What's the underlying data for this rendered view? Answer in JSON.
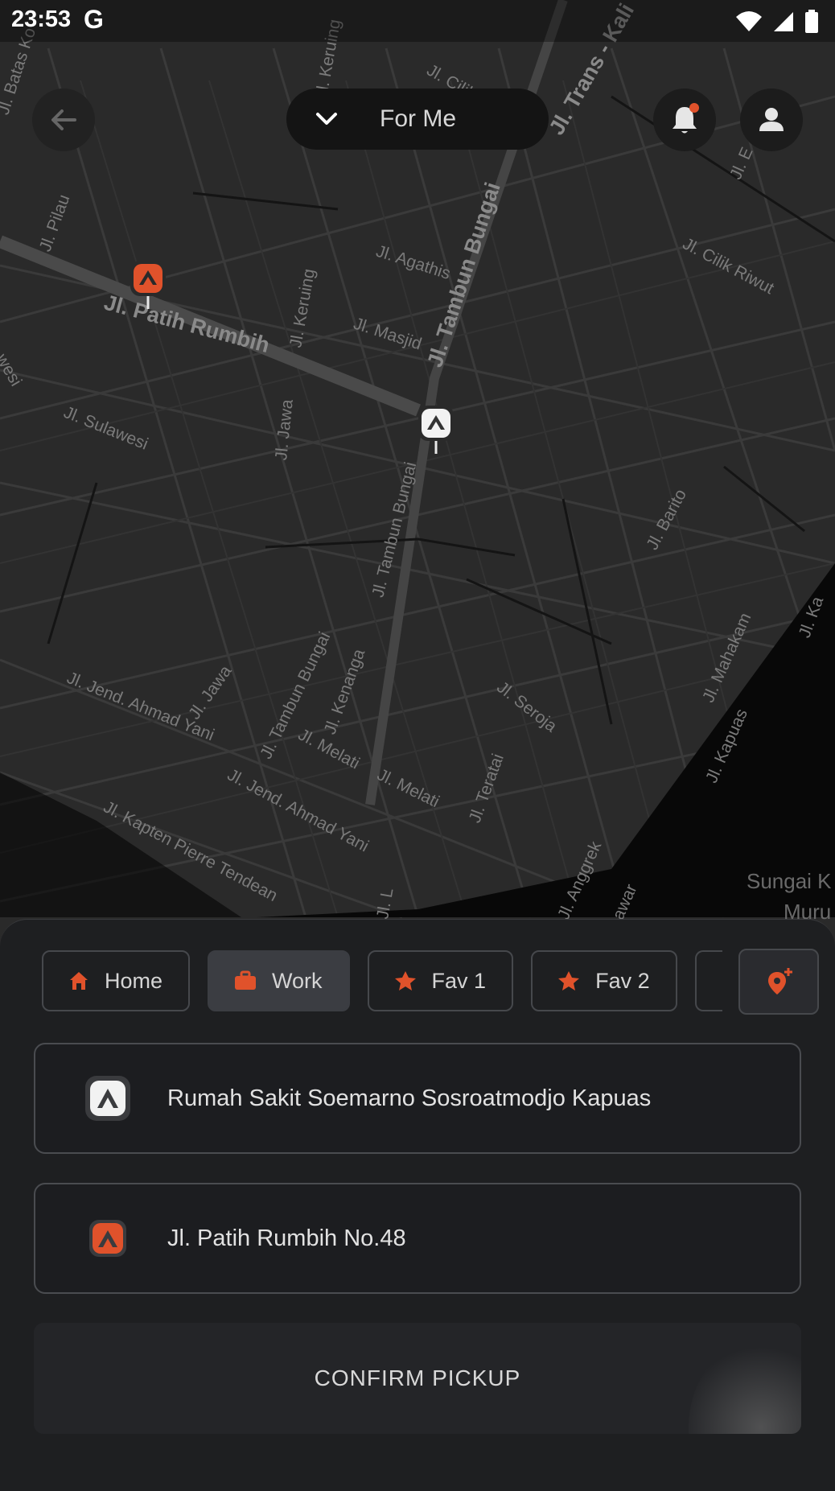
{
  "status_bar": {
    "time": "23:53",
    "app_glyph": "G"
  },
  "header": {
    "for_me_label": "For Me"
  },
  "map": {
    "streets": [
      "Jl. Trans - Kali",
      "Jl. Tambun Bungai",
      "Jl. Patih Rumbih",
      "Jl. Agathis",
      "Jl. Cilik Riwut",
      "Jl. Masjid",
      "Jl. Keruing",
      "Jl. Keruing",
      "Jl. Pilau",
      "Jl. Sulawesi",
      "Jl. Jawa",
      "Jl. Tambun Bungai",
      "Jl. Barito",
      "Jl. Seroja",
      "Jl. Mahakam",
      "Jl. Kenanga",
      "Jl. Tambun Bungai",
      "Jl. Jawa",
      "Jl. Jend. Ahmad Yani",
      "Jl. Melati",
      "Jl. Melati",
      "Jl. Jend. Ahmad Yani",
      "Jl. Teratai",
      "Jl. Kapuas",
      "Jl. Kapten Pierre Tendean",
      "Jl. Anggrek",
      "Sungai K",
      "Muru",
      "Jl. Cilik",
      "Jl. Batas Ko",
      "Jl. Ka",
      "Jl. L",
      "awar",
      "wesi",
      "Jl. E"
    ]
  },
  "chips": [
    {
      "label": "Home",
      "icon": "home-icon",
      "active": false
    },
    {
      "label": "Work",
      "icon": "briefcase-icon",
      "active": true
    },
    {
      "label": "Fav 1",
      "icon": "star-icon",
      "active": false
    },
    {
      "label": "Fav 2",
      "icon": "star-icon",
      "active": false
    }
  ],
  "destination": {
    "label": "Rumah Sakit Soemarno Sosroatmodjo Kapuas"
  },
  "pickup": {
    "label": "Jl. Patih Rumbih No.48"
  },
  "confirm_button": {
    "label": "CONFIRM PICKUP"
  },
  "colors": {
    "accent": "#e0522b",
    "background": "#1e1f21",
    "map": "#2a2a2a"
  }
}
